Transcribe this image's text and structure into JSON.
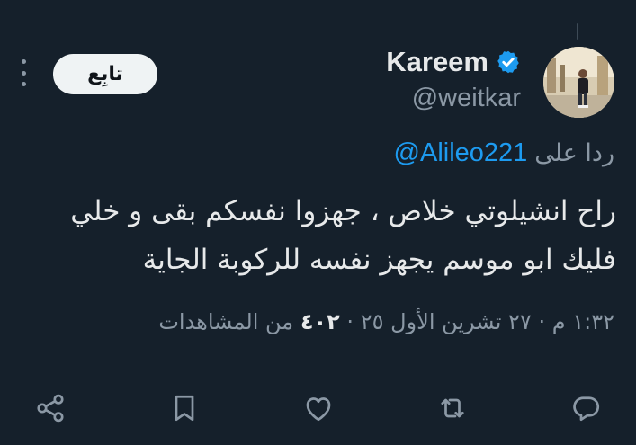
{
  "author": {
    "display_name": "Kareem",
    "handle": "@weitkar",
    "verified": true,
    "avatar_icon": "profile-photo"
  },
  "follow_button": {
    "label": "تابِع"
  },
  "reply_context": {
    "prefix": "ردا على",
    "handle": "@Alileo221"
  },
  "tweet": {
    "text": "راح انشيلوتي خلاص ، جهزوا نفسكم بقى و خلي فليك ابو موسم يجهز نفسه للركوبة الجاية"
  },
  "meta": {
    "time": "١:٣٢ م",
    "separator": "·",
    "date": "٢٧ تشرين الأول ٢٥",
    "views_count": "٤٠٢",
    "views_label": "من المشاهدات"
  },
  "actions": [
    {
      "icon": "share-icon"
    },
    {
      "icon": "bookmark-icon"
    },
    {
      "icon": "like-icon"
    },
    {
      "icon": "retweet-icon"
    },
    {
      "icon": "reply-icon"
    }
  ],
  "colors": {
    "background": "#15202b",
    "primary_text": "#e7e9ea",
    "secondary_text": "#8b98a5",
    "accent": "#1d9bf0",
    "follow_bg": "#eff3f4"
  }
}
